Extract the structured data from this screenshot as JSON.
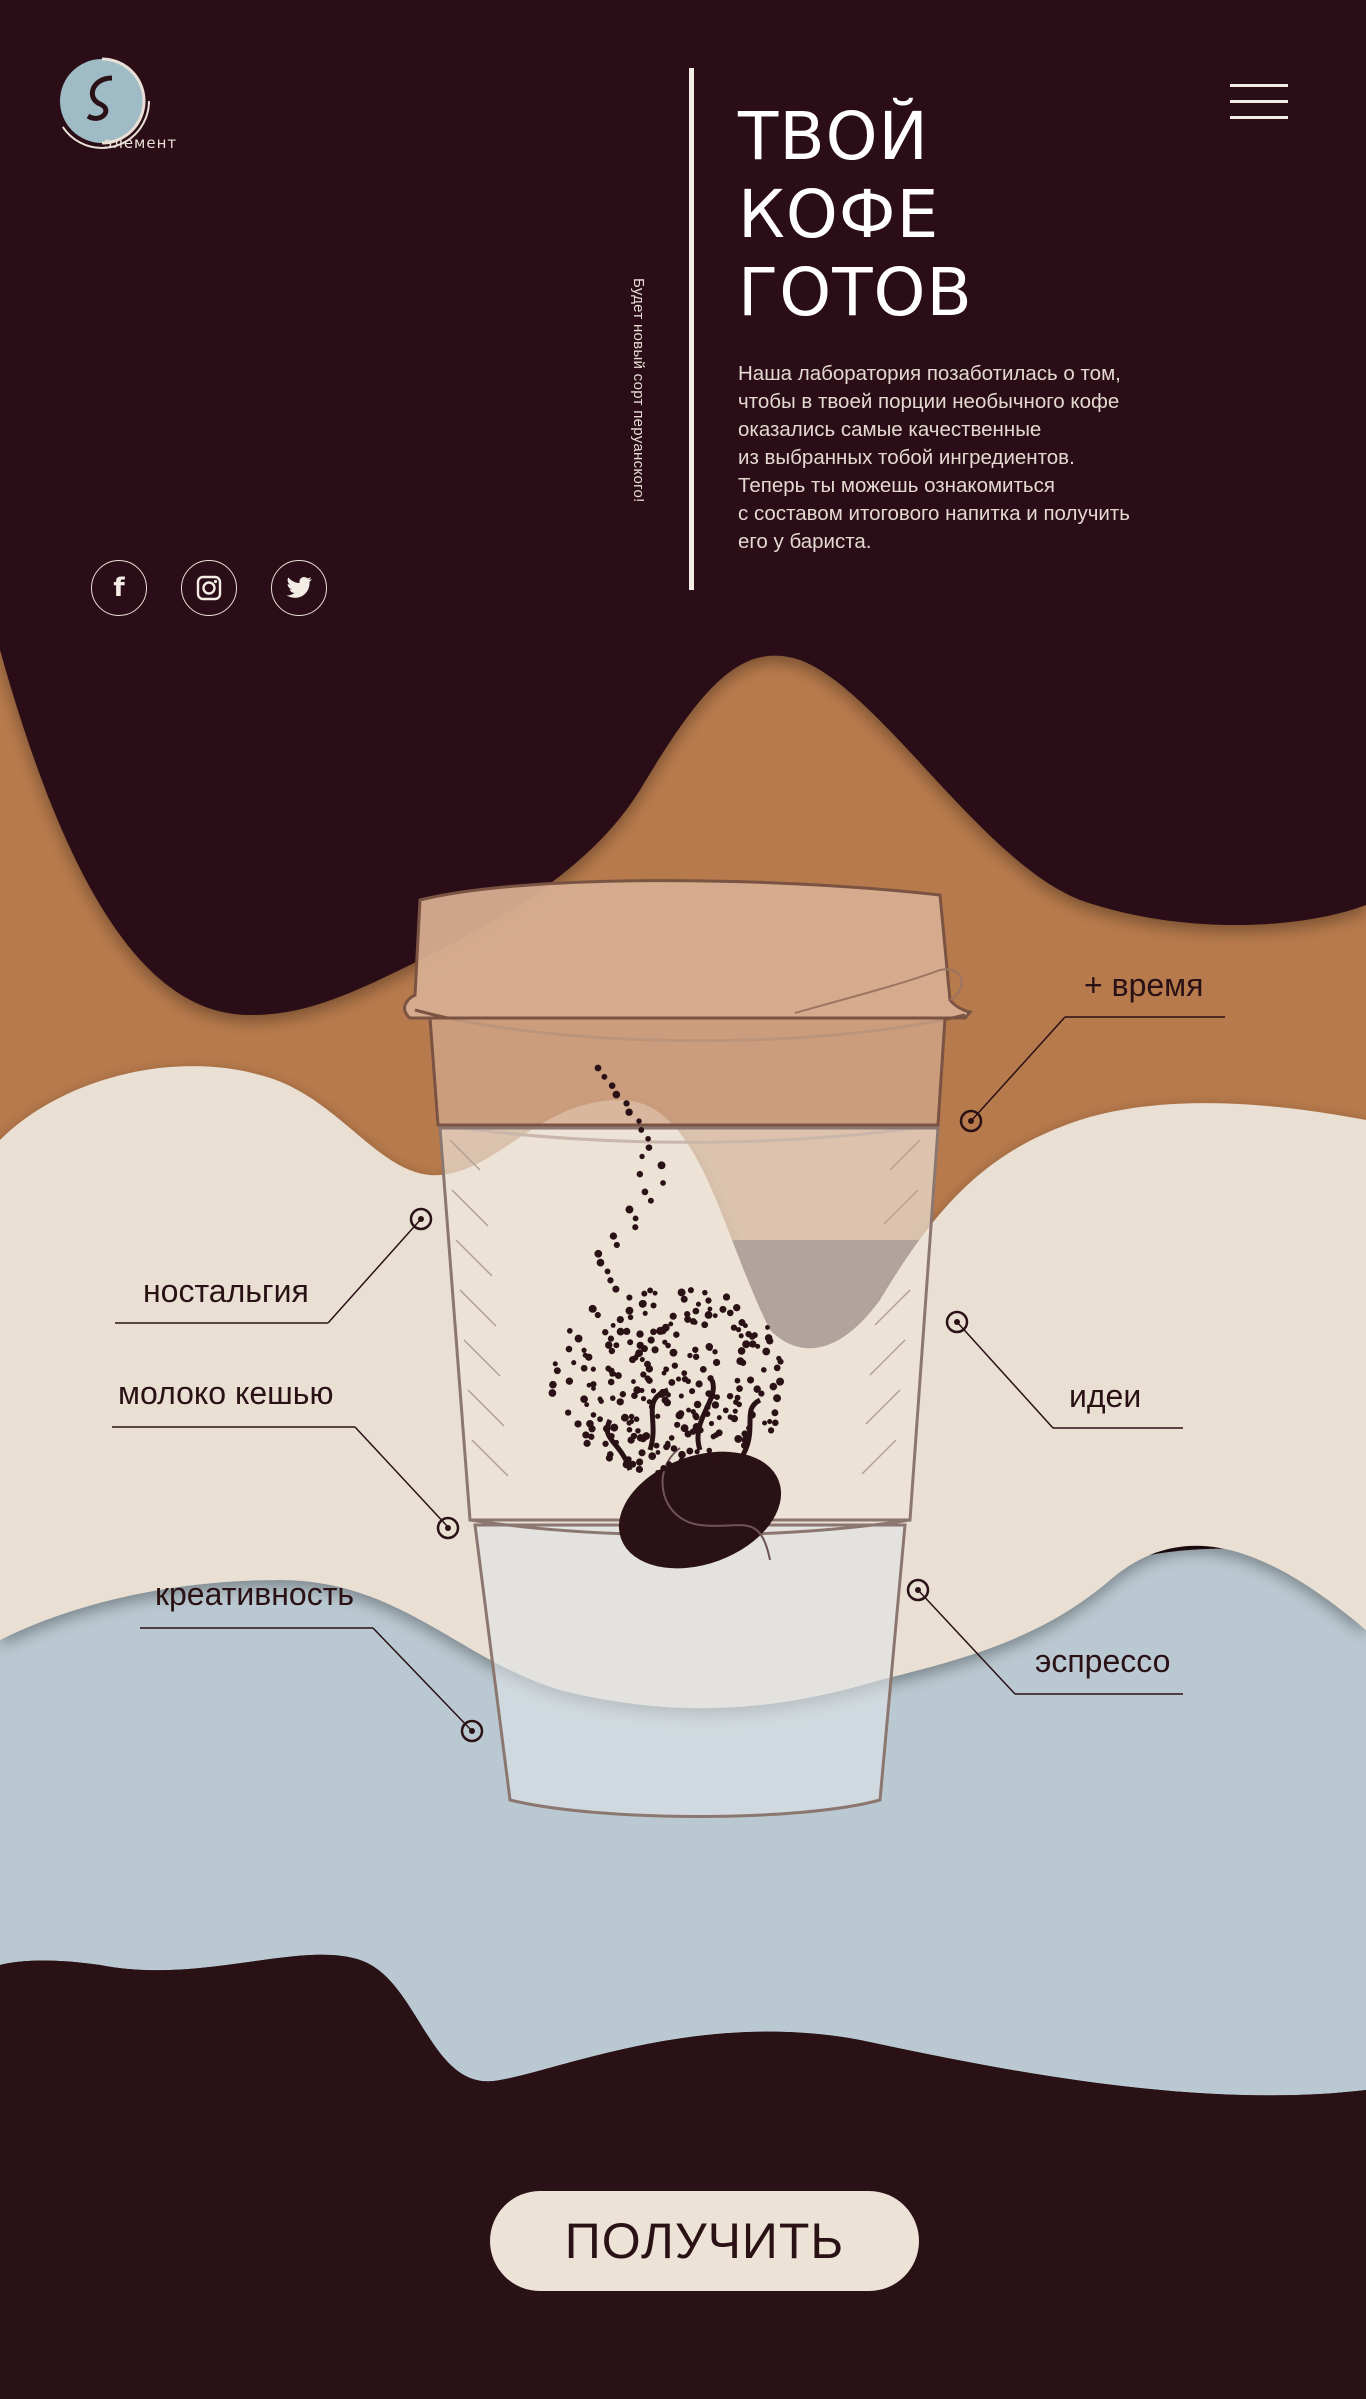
{
  "brand": {
    "logo_text": "элемент"
  },
  "header": {
    "side_note": "Будет новый сорт перуанского!",
    "headline": [
      "ТВОЙ",
      "КОФЕ",
      "ГОТОВ"
    ],
    "intro_lines": [
      "Наша лаборатория позаботилась о том,",
      "чтобы в твоей порции необычного кофе",
      "оказались самые качественные",
      "из выбранных тобой ингредиентов.",
      "Теперь ты можешь ознакомиться",
      "с составом итогового  напитка и получить",
      "его у бариста."
    ]
  },
  "social": [
    {
      "icon": "facebook-icon",
      "glyph": "f"
    },
    {
      "icon": "instagram-icon",
      "glyph": "◎"
    },
    {
      "icon": "twitter-icon",
      "glyph": "🐦"
    }
  ],
  "ingredients": {
    "time": "+ время",
    "nostalgia": "ностальгия",
    "ideas": "идеи",
    "cashew_milk": "молоко кешью",
    "creativity": "креативность",
    "espresso": "эспрессо"
  },
  "cta": {
    "label": "ПОЛУЧИТЬ"
  },
  "colors": {
    "dark": "#2a1115",
    "caramel": "#b77a4c",
    "cream": "#e9dfd3",
    "blue": "#bac9d1",
    "button": "#ece2d6"
  }
}
